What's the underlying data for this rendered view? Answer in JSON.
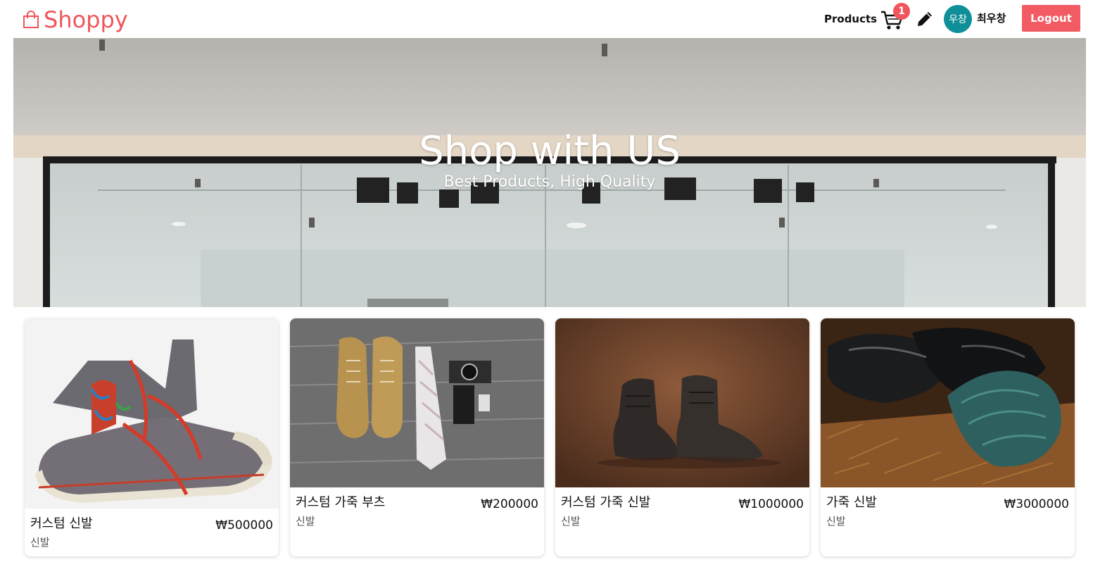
{
  "header": {
    "brand": "Shoppy",
    "nav_products": "Products",
    "cart_count": "1",
    "avatar_text": "우창",
    "user_name": "최우창",
    "logout_label": "Logout",
    "colors": {
      "brand": "#f0555b",
      "avatar": "#0f8f98",
      "logout": "#f25b63"
    },
    "icons": [
      "shopping-bag-icon",
      "cart-icon",
      "pencil-icon"
    ]
  },
  "hero": {
    "title": "Shop with US",
    "subtitle": "Best Products, High Quality"
  },
  "products": [
    {
      "title": "커스텀 신발",
      "price": "₩500000",
      "category": "신발"
    },
    {
      "title": "커스텀 가죽 부츠",
      "price": "₩200000",
      "category": "신발"
    },
    {
      "title": "커스텀 가죽 신발",
      "price": "₩1000000",
      "category": "신발"
    },
    {
      "title": "가죽 신발",
      "price": "₩3000000",
      "category": "신발"
    }
  ]
}
